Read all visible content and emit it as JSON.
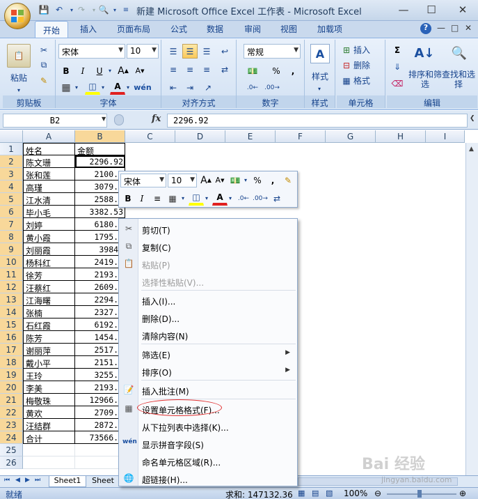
{
  "window": {
    "title": "新建 Microsoft Office Excel 工作表 - Microsoft Excel",
    "minimize": "—",
    "maximize": "☐",
    "close": "✕"
  },
  "ribbon_tabs": [
    "开始",
    "插入",
    "页面布局",
    "公式",
    "数据",
    "审阅",
    "视图",
    "加载项"
  ],
  "ribbon": {
    "clipboard": {
      "label": "剪贴板",
      "paste": "粘贴"
    },
    "font": {
      "label": "字体",
      "name": "宋体",
      "size": "10"
    },
    "alignment": {
      "label": "对齐方式"
    },
    "number": {
      "label": "数字",
      "format": "常规",
      "percent": "%",
      "comma": ","
    },
    "styles": {
      "label": "样式"
    },
    "cells": {
      "label": "单元格",
      "insert": "插入",
      "delete": "删除",
      "format": "格式"
    },
    "editing": {
      "label": "编辑",
      "sort_filter": "排序和筛选",
      "find_select": "查找和选择"
    }
  },
  "formula_bar": {
    "name_box": "B2",
    "fx": "fx",
    "value": "2296.92"
  },
  "columns": [
    "A",
    "B",
    "C",
    "D",
    "E",
    "F",
    "G",
    "H",
    "I"
  ],
  "rows": [
    {
      "n": "1",
      "a": "姓名",
      "b": "金额"
    },
    {
      "n": "2",
      "a": "陈文珊",
      "b": "2296.92"
    },
    {
      "n": "3",
      "a": "张和莲",
      "b": "2100.3"
    },
    {
      "n": "4",
      "a": "高瑾",
      "b": "3079.3"
    },
    {
      "n": "5",
      "a": "江水清",
      "b": "2588.3"
    },
    {
      "n": "6",
      "a": "毕小毛",
      "b": "3382.53"
    },
    {
      "n": "7",
      "a": "刘婷",
      "b": "6180.6"
    },
    {
      "n": "8",
      "a": "黄小霞",
      "b": "1795.3"
    },
    {
      "n": "9",
      "a": "刘丽霞",
      "b": "3984."
    },
    {
      "n": "10",
      "a": "杨科红",
      "b": "2419.2"
    },
    {
      "n": "11",
      "a": "徐芳",
      "b": "2193.3"
    },
    {
      "n": "12",
      "a": "汪蔡红",
      "b": "2609.3"
    },
    {
      "n": "13",
      "a": "江海曙",
      "b": "2294.9"
    },
    {
      "n": "14",
      "a": "张楠",
      "b": "2327.6"
    },
    {
      "n": "15",
      "a": "石红霞",
      "b": "6192.8"
    },
    {
      "n": "16",
      "a": "陈芳",
      "b": "1454.9"
    },
    {
      "n": "17",
      "a": "谢丽萍",
      "b": "2517.3"
    },
    {
      "n": "18",
      "a": "戴小平",
      "b": "2151.3"
    },
    {
      "n": "19",
      "a": "王玲",
      "b": "3255.3"
    },
    {
      "n": "20",
      "a": "李美",
      "b": "2193.3"
    },
    {
      "n": "21",
      "a": "梅敬珠",
      "b": "12966.5"
    },
    {
      "n": "22",
      "a": "黄欢",
      "b": "2709.3"
    },
    {
      "n": "23",
      "a": "汪结群",
      "b": "2872.3"
    },
    {
      "n": "24",
      "a": "合计",
      "b": "73566.1"
    },
    {
      "n": "25",
      "a": "",
      "b": ""
    },
    {
      "n": "26",
      "a": "",
      "b": ""
    }
  ],
  "mini_toolbar": {
    "font": "宋体",
    "size": "10",
    "percent": "%",
    "comma": ","
  },
  "context_menu": [
    {
      "label": "剪切(T)",
      "icon": "scissors-icon",
      "enabled": true
    },
    {
      "label": "复制(C)",
      "icon": "copy-icon",
      "enabled": true
    },
    {
      "label": "粘贴(P)",
      "icon": "paste-icon",
      "enabled": false
    },
    {
      "label": "选择性粘贴(V)...",
      "icon": "",
      "enabled": false
    },
    {
      "label": "插入(I)...",
      "icon": "",
      "enabled": true
    },
    {
      "label": "删除(D)...",
      "icon": "",
      "enabled": true
    },
    {
      "label": "清除内容(N)",
      "icon": "",
      "enabled": true
    },
    {
      "label": "筛选(E)",
      "icon": "",
      "enabled": true,
      "submenu": true
    },
    {
      "label": "排序(O)",
      "icon": "",
      "enabled": true,
      "submenu": true
    },
    {
      "label": "插入批注(M)",
      "icon": "comment-icon",
      "enabled": true
    },
    {
      "label": "设置单元格格式(F)...",
      "icon": "format-cells-icon",
      "enabled": true,
      "highlighted": true
    },
    {
      "label": "从下拉列表中选择(K)...",
      "icon": "",
      "enabled": true
    },
    {
      "label": "显示拼音字段(S)",
      "icon": "phonetic-icon",
      "enabled": true
    },
    {
      "label": "命名单元格区域(R)...",
      "icon": "",
      "enabled": true
    },
    {
      "label": "超链接(H)...",
      "icon": "hyperlink-icon",
      "enabled": true
    }
  ],
  "sheet_tabs": [
    "Sheet1",
    "Sheet"
  ],
  "status": {
    "ready": "就绪",
    "sum": "求和: 147132.36",
    "zoom": "100%"
  },
  "watermark": {
    "text": "Bai 经验",
    "url": "jingyan.baidu.com"
  },
  "colors": {
    "accent": "#15428b",
    "selected_header": "#f8d89a",
    "ribbon_bg": "#dbe7f5"
  }
}
